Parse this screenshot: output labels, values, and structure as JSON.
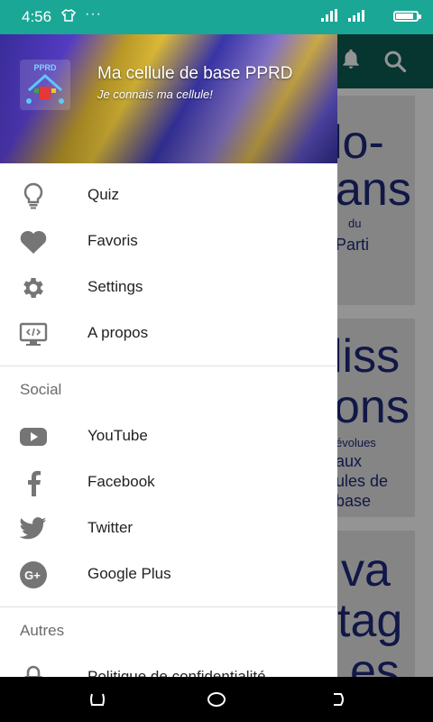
{
  "status_bar": {
    "time": "4:56",
    "notif_dots": "···",
    "signal": "…│┃ …│┃",
    "battery_level": 0.85
  },
  "drawer_header": {
    "title": "Ma cellule de base PPRD",
    "subtitle": "Je connais ma cellule!",
    "logo_text": "PPRD"
  },
  "menu": {
    "main": [
      {
        "label": "Quiz",
        "icon": "lightbulb-icon"
      },
      {
        "label": "Favoris",
        "icon": "heart-icon"
      },
      {
        "label": "Settings",
        "icon": "gear-icon"
      },
      {
        "label": "A propos",
        "icon": "code-monitor-icon"
      }
    ],
    "social_title": "Social",
    "social": [
      {
        "label": "YouTube",
        "icon": "youtube-icon"
      },
      {
        "label": "Facebook",
        "icon": "facebook-icon"
      },
      {
        "label": "Twitter",
        "icon": "twitter-icon"
      },
      {
        "label": "Google Plus",
        "icon": "google-plus-icon"
      }
    ],
    "other_title": "Autres",
    "other": [
      {
        "label": "Politique de confidentialité",
        "icon": "lock-icon"
      }
    ]
  },
  "background_app": {
    "card1": {
      "big1": "lo-",
      "big2": "ans",
      "small1": "du",
      "small2": "Parti"
    },
    "card2": {
      "big1": "liss",
      "big2": "ons",
      "small1": "évolues",
      "small2": "aux",
      "small3": "ules de",
      "small4": "base"
    },
    "card3": {
      "big1": "va",
      "big2": "tag",
      "big3": "es"
    }
  },
  "colors": {
    "status_bar": "#1aa796",
    "toolbar": "#0d5c52",
    "text_dark": "#222222",
    "section_gray": "#6b6b6b",
    "icon_gray": "#757575"
  }
}
